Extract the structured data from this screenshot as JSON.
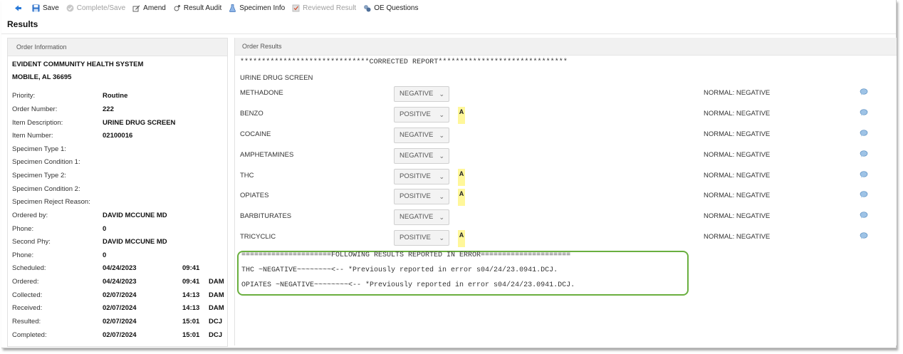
{
  "toolbar": {
    "items": [
      {
        "label": "",
        "icon": "back-arrow-icon",
        "enabled": true
      },
      {
        "label": "Save",
        "icon": "save-icon",
        "enabled": true
      },
      {
        "label": "Complete/Save",
        "icon": "complete-check-icon",
        "enabled": false
      },
      {
        "label": "Amend",
        "icon": "amend-pencil-icon",
        "enabled": true
      },
      {
        "label": "Result Audit",
        "icon": "audit-icon",
        "enabled": true
      },
      {
        "label": "Specimen Info",
        "icon": "specimen-flask-icon",
        "enabled": true
      },
      {
        "label": "Reviewed Result",
        "icon": "reviewed-icon",
        "enabled": false
      },
      {
        "label": "OE Questions",
        "icon": "questions-icon",
        "enabled": true
      }
    ]
  },
  "page": {
    "title": "Results"
  },
  "order_info": {
    "header": "Order Information",
    "org_name": "EVIDENT COMMUNITY HEALTH SYSTEM",
    "org_city": "MOBILE, AL 36695",
    "fields": [
      {
        "label": "Priority:",
        "value": "Routine"
      },
      {
        "label": "Order Number:",
        "value": "222"
      },
      {
        "label": "Item Description:",
        "value": "URINE DRUG SCREEN"
      },
      {
        "label": "Item Number:",
        "value": "02100016"
      },
      {
        "label": "Specimen Type 1:",
        "value": ""
      },
      {
        "label": "Specimen Condition 1:",
        "value": ""
      },
      {
        "label": "Specimen Type 2:",
        "value": ""
      },
      {
        "label": "Specimen Condition 2:",
        "value": ""
      },
      {
        "label": "Specimen Reject Reason:",
        "value": ""
      },
      {
        "label": "Ordered by:",
        "value": "DAVID MCCUNE MD"
      },
      {
        "label": "Phone:",
        "value": "0"
      },
      {
        "label": "Second Phy:",
        "value": "DAVID MCCUNE MD"
      },
      {
        "label": "Phone:",
        "value": "0"
      }
    ],
    "events": [
      {
        "label": "Scheduled:",
        "date": "04/24/2023",
        "time": "09:41",
        "user": ""
      },
      {
        "label": "Ordered:",
        "date": "04/24/2023",
        "time": "09:41",
        "user": "DAM"
      },
      {
        "label": "Collected:",
        "date": "02/07/2024",
        "time": "14:13",
        "user": "DAM"
      },
      {
        "label": "Received:",
        "date": "02/07/2024",
        "time": "14:13",
        "user": "DAM"
      },
      {
        "label": "Resulted:",
        "date": "02/07/2024",
        "time": "15:01",
        "user": "DCJ"
      },
      {
        "label": "Completed:",
        "date": "02/07/2024",
        "time": "15:01",
        "user": "DCJ"
      }
    ]
  },
  "order_results": {
    "header": "Order Results",
    "corrected_line": "******************************CORRECTED REPORT******************************",
    "section_title": "URINE DRUG SCREEN",
    "rows": [
      {
        "name": "METHADONE",
        "value": "NEGATIVE",
        "flag": "",
        "normal": "NORMAL: NEGATIVE"
      },
      {
        "name": "BENZO",
        "value": "POSITIVE",
        "flag": "A",
        "normal": "NORMAL: NEGATIVE"
      },
      {
        "name": "COCAINE",
        "value": "NEGATIVE",
        "flag": "",
        "normal": "NORMAL: NEGATIVE"
      },
      {
        "name": "AMPHETAMINES",
        "value": "NEGATIVE",
        "flag": "",
        "normal": "NORMAL: NEGATIVE"
      },
      {
        "name": "THC",
        "value": "POSITIVE",
        "flag": "A",
        "normal": "NORMAL: NEGATIVE"
      },
      {
        "name": "OPIATES",
        "value": "POSITIVE",
        "flag": "A",
        "normal": "NORMAL: NEGATIVE"
      },
      {
        "name": "BARBITURATES",
        "value": "NEGATIVE",
        "flag": "",
        "normal": "NORMAL: NEGATIVE"
      },
      {
        "name": "TRICYCLIC",
        "value": "POSITIVE",
        "flag": "A",
        "normal": "NORMAL: NEGATIVE"
      }
    ],
    "following": {
      "header": "=====================FOLLOWING RESULTS REPORTED IN ERROR=====================",
      "lines": [
        "THC ~NEGATIVE~~~~~~~~<-- *Previously reported in error s04/24/23.0941.DCJ.",
        "OPIATES ~NEGATIVE~~~~~~~~<-- *Previously reported in error s04/24/23.0941.DCJ."
      ]
    }
  },
  "colors": {
    "flag_bg": "#fff79a",
    "highlight_border": "#6aaf3f",
    "toolbar_icon": "#2a6fc9"
  }
}
